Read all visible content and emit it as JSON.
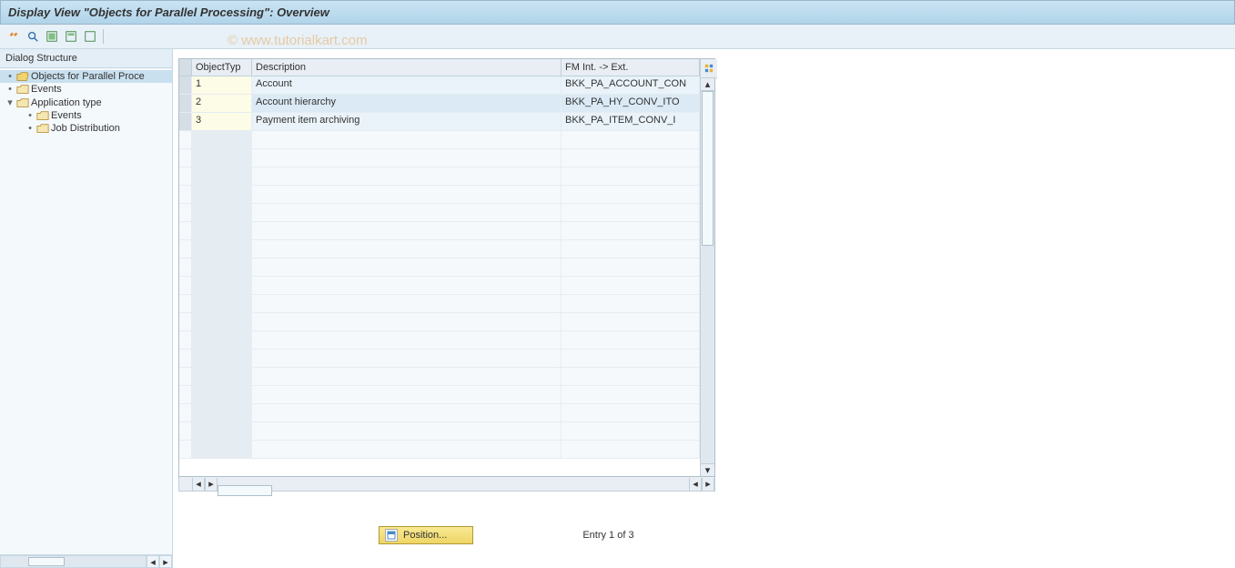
{
  "title": "Display View \"Objects for Parallel Processing\": Overview",
  "watermark": "© www.tutorialkart.com",
  "sidebar": {
    "header": "Dialog Structure",
    "items": [
      {
        "label": "Objects for Parallel Proce",
        "kind": "open",
        "level": 0,
        "selected": true,
        "bullet": true
      },
      {
        "label": "Events",
        "kind": "closed",
        "level": 0,
        "bullet": true
      },
      {
        "label": "Application type",
        "kind": "closed",
        "level": 0,
        "expander": "down"
      },
      {
        "label": "Events",
        "kind": "closed",
        "level": 1,
        "bullet": true
      },
      {
        "label": "Job Distribution",
        "kind": "closed",
        "level": 1,
        "bullet": true
      }
    ]
  },
  "table": {
    "columns": {
      "c1": "ObjectTyp",
      "c2": "Description",
      "c3": "FM Int. -> Ext."
    },
    "rows": [
      {
        "typ": "1",
        "desc": "Account",
        "fm": "BKK_PA_ACCOUNT_CON"
      },
      {
        "typ": "2",
        "desc": "Account hierarchy",
        "fm": "BKK_PA_HY_CONV_ITO"
      },
      {
        "typ": "3",
        "desc": "Payment item archiving",
        "fm": "BKK_PA_ITEM_CONV_I"
      }
    ]
  },
  "footer": {
    "position": "Position...",
    "entry": "Entry 1 of 3"
  }
}
